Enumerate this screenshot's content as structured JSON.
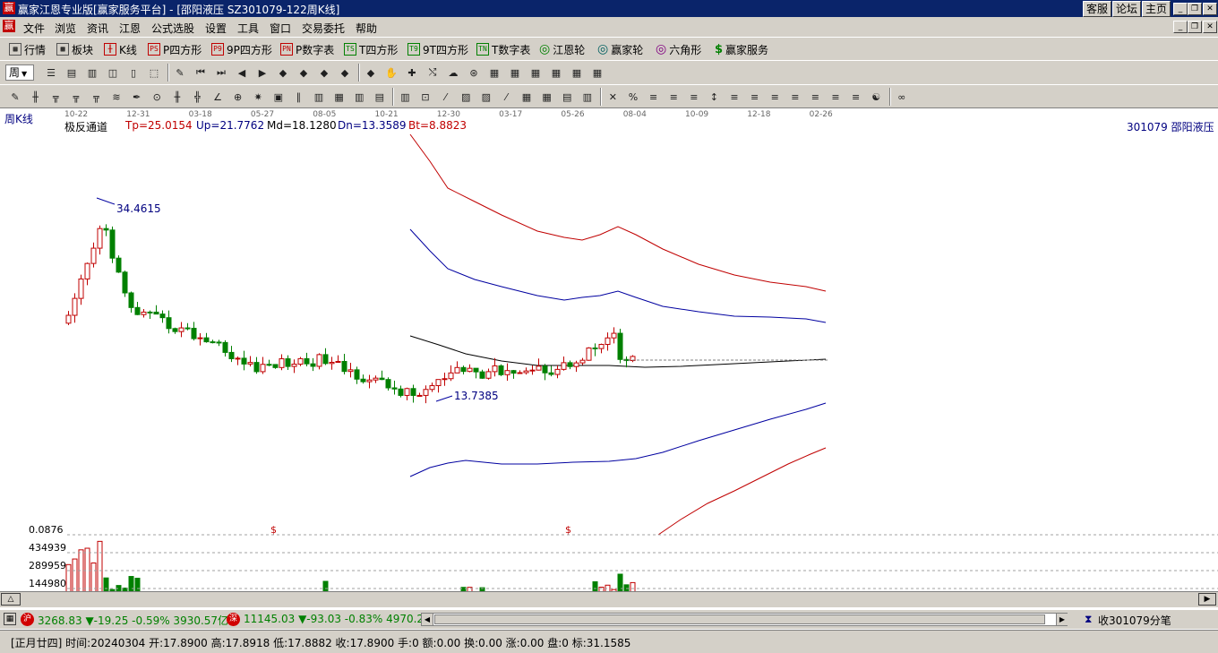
{
  "window": {
    "title": "赢家江恩专业版[赢家服务平台] - [邵阳液压  SZ301079-122周K线]",
    "links": [
      "客服",
      "论坛",
      "主页"
    ]
  },
  "menu": [
    "文件",
    "浏览",
    "资讯",
    "江恩",
    "公式选股",
    "设置",
    "工具",
    "窗口",
    "交易委托",
    "帮助"
  ],
  "toolbar1": [
    {
      "label": "行情",
      "icon": "grid-icon"
    },
    {
      "label": "板块",
      "icon": "blocks-icon"
    },
    {
      "label": "K线",
      "icon": "candle-icon"
    },
    {
      "label": "P四方形",
      "icon": "ps-icon",
      "tag": "PS"
    },
    {
      "label": "9P四方形",
      "icon": "p9-icon",
      "tag": "P9"
    },
    {
      "label": "P数字表",
      "icon": "pn-icon",
      "tag": "PN"
    },
    {
      "label": "T四方形",
      "icon": "ts-icon",
      "tag": "TS"
    },
    {
      "label": "9T四方形",
      "icon": "t9-icon",
      "tag": "T9"
    },
    {
      "label": "T数字表",
      "icon": "tn-icon",
      "tag": "TN"
    },
    {
      "label": "江恩轮",
      "icon": "gann-wheel-icon",
      "tag": "◎"
    },
    {
      "label": "赢家轮",
      "icon": "winner-wheel-icon",
      "tag": "◎"
    },
    {
      "label": "六角形",
      "icon": "hexagon-icon",
      "tag": "◎"
    },
    {
      "label": "赢家服务",
      "icon": "dollar-icon",
      "tag": "$"
    }
  ],
  "toolbar2": {
    "period": "周"
  },
  "chart": {
    "period_label": "周K线",
    "indicator_name": "极反通道",
    "tp": "Tp=25.0154",
    "up": "Up=21.7762",
    "md": "Md=18.1280",
    "dn": "Dn=13.3589",
    "bt": "Bt=8.8823",
    "stock": "301079  邵阳液压",
    "high_label": "34.4615",
    "low_label": "13.7385",
    "time_ticks": [
      "10-22",
      "12-31",
      "03-18",
      "05-27",
      "08-05",
      "10-21",
      "12-30",
      "03-17",
      "05-26",
      "08-04",
      "10-09",
      "12-18",
      "02-26"
    ],
    "volume_ticks": [
      "0.0876",
      "434939",
      "289959",
      "144980"
    ],
    "dollar_marks": [
      "$",
      "$"
    ]
  },
  "chart_data": {
    "type": "candlestick",
    "title": "周K线",
    "high": 34.4615,
    "low": 13.7385,
    "channel": {
      "Tp": 25.0154,
      "Up": 21.7762,
      "Md": 18.128,
      "Dn": 13.3589,
      "Bt": 8.8823
    },
    "volume_axis_labels": [
      "0.0876",
      "434939",
      "289959",
      "144980"
    ]
  },
  "status1": {
    "sh_badge": "沪",
    "sh_text": "3268.83 ▼-19.25 -0.59% 3930.57亿",
    "sz_badge": "深",
    "sz_text": "11145.03 ▼-93.03 -0.83% 4970.2",
    "ticks_label": "收301079分笔"
  },
  "status2": {
    "text": "[正月廿四] 时间:20240304 开:17.8900 高:17.8918 低:17.8882 收:17.8900 手:0 额:0.00 换:0.00 涨:0.00 盘:0 标:31.1585"
  },
  "colors": {
    "titlebar": "#0a246a",
    "up": "#c00000",
    "down": "#008000",
    "blue_band": "#0000a0",
    "red_band": "#c00000"
  }
}
